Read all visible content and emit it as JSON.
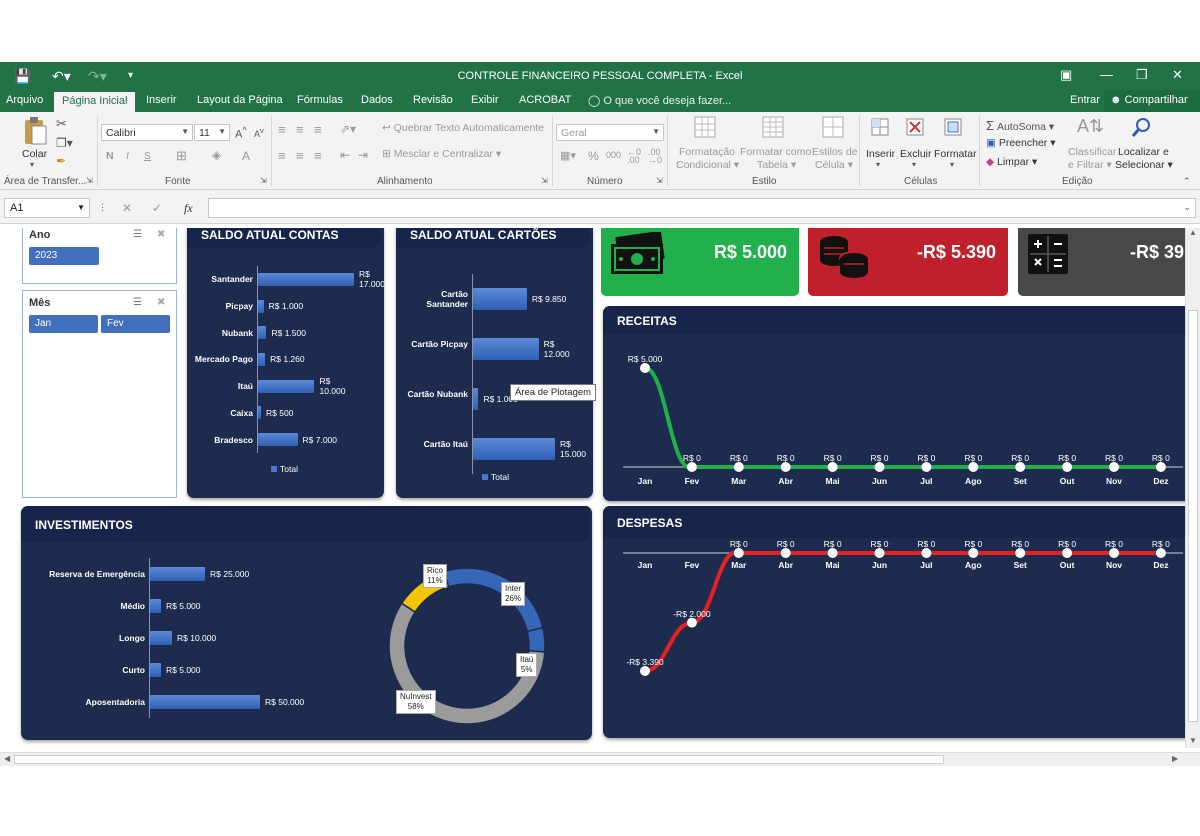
{
  "window": {
    "title": "CONTROLE FINANCEIRO PESSOAL COMPLETA - Excel",
    "colors": {
      "excel_green": "#217346"
    }
  },
  "ribbon_tabs": [
    "Arquivo",
    "Página Inicial",
    "Inserir",
    "Layout da Página",
    "Fórmulas",
    "Dados",
    "Revisão",
    "Exibir",
    "ACROBAT"
  ],
  "tell_me": "O que você deseja fazer...",
  "sign_in": "Entrar",
  "share": "Compartilhar",
  "ribbon": {
    "clipboard": {
      "paste": "Colar",
      "group": "Área de Transfer..."
    },
    "font": {
      "name": "Calibri",
      "size": "11",
      "bold": "N",
      "italic": "I",
      "underline": "S",
      "group": "Fonte"
    },
    "alignment": {
      "wrap": "Quebrar Texto Automaticamente",
      "merge": "Mesclar e Centralizar",
      "group": "Alinhamento"
    },
    "number": {
      "format": "Geral",
      "percent": "%",
      "thousands": "000",
      "group": "Número"
    },
    "styles": {
      "conditional_1": "Formatação",
      "conditional_2": "Condicional",
      "table_1": "Formatar como",
      "table_2": "Tabela",
      "cell_1": "Estilos de",
      "cell_2": "Célula",
      "group": "Estilo"
    },
    "cells": {
      "insert": "Inserir",
      "delete": "Excluir",
      "format": "Formatar",
      "group": "Células"
    },
    "editing": {
      "autosum": "AutoSoma",
      "fill": "Preencher",
      "clear": "Limpar",
      "sort_1": "Classificar",
      "sort_2": "e Filtrar",
      "find_1": "Localizar e",
      "find_2": "Selecionar",
      "group": "Edição"
    }
  },
  "formula_bar": {
    "name_box": "A1",
    "fx": "fx"
  },
  "slicers": {
    "ano": {
      "title": "Ano",
      "items": [
        "2023"
      ]
    },
    "mes": {
      "title": "Mês",
      "items": [
        "Jan",
        "Fev"
      ]
    }
  },
  "kpis": [
    {
      "value": "R$ 5.000",
      "color": "#21b04b",
      "icon": "money-bill-icon"
    },
    {
      "value": "-R$ 5.390",
      "color": "#c0202b",
      "icon": "coins-icon"
    },
    {
      "value": "-R$ 39",
      "color": "#484848",
      "icon": "calculator-icon"
    }
  ],
  "tooltip": "Área de Plotagem",
  "chart_data": [
    {
      "type": "bar",
      "title": "SALDO ATUAL CONTAS",
      "orientation": "horizontal",
      "categories": [
        "Santander",
        "Picpay",
        "Nubank",
        "Mercado Pago",
        "Itaú",
        "Caixa",
        "Bradesco"
      ],
      "values": [
        17000,
        1000,
        1500,
        1260,
        10000,
        500,
        7000
      ],
      "data_labels": [
        "R$ 17.000",
        "R$ 1.000",
        "R$ 1.500",
        "R$ 1.260",
        "R$ 10.000",
        "R$ 500",
        "R$ 7.000"
      ],
      "legend": "Total"
    },
    {
      "type": "bar",
      "title": "SALDO ATUAL CARTÕES",
      "orientation": "horizontal",
      "categories": [
        "Cartão Santander",
        "Cartão Picpay",
        "Cartão Nubank",
        "Cartão Itaú"
      ],
      "values": [
        9850,
        12000,
        1000,
        15000
      ],
      "data_labels": [
        "R$ 9.850",
        "R$ 12.000",
        "R$ 1.000",
        "R$ 15.000"
      ],
      "legend": "Total"
    },
    {
      "type": "bar",
      "title": "INVESTIMENTOS",
      "orientation": "horizontal",
      "categories": [
        "Reserva de Emergência",
        "Médio",
        "Longo",
        "Curto",
        "Aposentadoria"
      ],
      "values": [
        25000,
        5000,
        10000,
        5000,
        50000
      ],
      "data_labels": [
        "R$ 25.000",
        "R$ 5.000",
        "R$ 10.000",
        "R$ 5.000",
        "R$ 50.000"
      ]
    },
    {
      "type": "pie",
      "slices": [
        {
          "name": "Inter",
          "pct": "26%",
          "value": 26,
          "color": "#3566b8"
        },
        {
          "name": "Itaú",
          "pct": "5%",
          "value": 5,
          "color": "#3566b8"
        },
        {
          "name": "NuInvest",
          "pct": "58%",
          "value": 58,
          "color": "#9b9b9b"
        },
        {
          "name": "Rico",
          "pct": "11%",
          "value": 11,
          "color": "#f2c500"
        }
      ]
    },
    {
      "type": "line",
      "title": "RECEITAS",
      "categories": [
        "Jan",
        "Fev",
        "Mar",
        "Abr",
        "Mai",
        "Jun",
        "Jul",
        "Ago",
        "Set",
        "Out",
        "Nov",
        "Dez"
      ],
      "values": [
        5000,
        0,
        0,
        0,
        0,
        0,
        0,
        0,
        0,
        0,
        0,
        0
      ],
      "data_labels": [
        "R$ 5.000",
        "R$ 0",
        "R$ 0",
        "R$ 0",
        "R$ 0",
        "R$ 0",
        "R$ 0",
        "R$ 0",
        "R$ 0",
        "R$ 0",
        "R$ 0",
        "R$ 0"
      ],
      "color": "#1fb04a"
    },
    {
      "type": "line",
      "title": "DESPESAS",
      "categories": [
        "Jan",
        "Fev",
        "Mar",
        "Abr",
        "Mai",
        "Jun",
        "Jul",
        "Ago",
        "Set",
        "Out",
        "Nov",
        "Dez"
      ],
      "values": [
        -3390,
        -2000,
        0,
        0,
        0,
        0,
        0,
        0,
        0,
        0,
        0,
        0
      ],
      "data_labels": [
        "-R$ 3.390",
        "-R$ 2.000",
        "R$ 0",
        "R$ 0",
        "R$ 0",
        "R$ 0",
        "R$ 0",
        "R$ 0",
        "R$ 0",
        "R$ 0",
        "R$ 0",
        "R$ 0"
      ],
      "color": "#e8201f"
    }
  ]
}
